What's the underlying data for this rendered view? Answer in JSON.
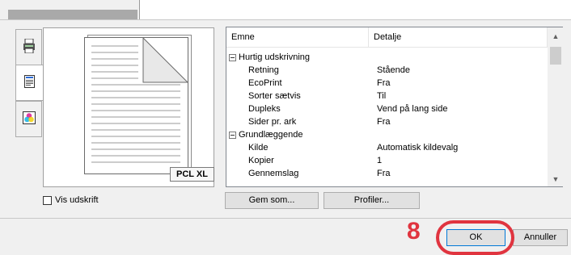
{
  "list": {
    "columns": [
      "Emne",
      "Detalje"
    ],
    "rows": [
      {
        "type": "group",
        "key": "Hurtig udskrivning",
        "value": ""
      },
      {
        "type": "item",
        "key": "Retning",
        "value": "Stående"
      },
      {
        "type": "item",
        "key": "EcoPrint",
        "value": "Fra"
      },
      {
        "type": "item",
        "key": "Sorter sætvis",
        "value": "Til"
      },
      {
        "type": "item",
        "key": "Dupleks",
        "value": "Vend på lang side"
      },
      {
        "type": "item",
        "key": "Sider pr. ark",
        "value": "Fra"
      },
      {
        "type": "group",
        "key": "Grundlæggende",
        "value": ""
      },
      {
        "type": "item",
        "key": "Kilde",
        "value": "Automatisk kildevalg"
      },
      {
        "type": "item",
        "key": "Kopier",
        "value": "1"
      },
      {
        "type": "item",
        "key": "Gennemslag",
        "value": "Fra"
      }
    ]
  },
  "preview": {
    "badge": "PCL XL"
  },
  "options": {
    "show_print_label": "Vis udskrift"
  },
  "buttons": {
    "save_as": "Gem som...",
    "profiles": "Profiler...",
    "ok": "OK",
    "cancel": "Annuller"
  },
  "annotation": {
    "step": "8",
    "color": "#e0343f"
  },
  "icons": {
    "tab1": "printer-icon",
    "tab2": "document-icon",
    "tab3": "color-icon"
  }
}
